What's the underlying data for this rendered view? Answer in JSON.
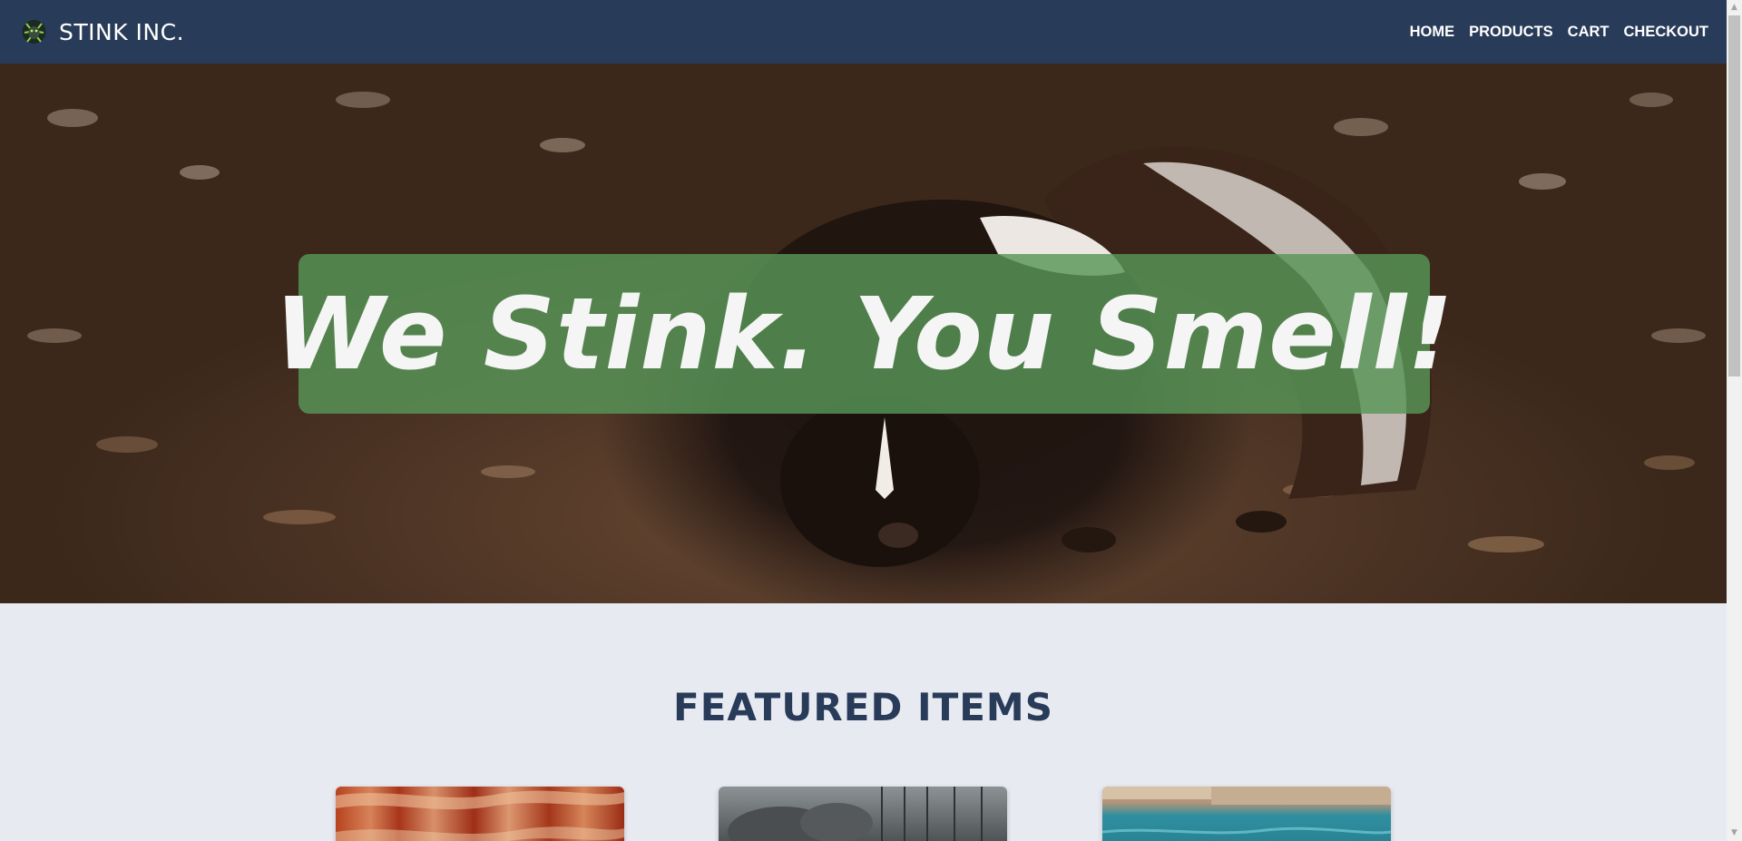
{
  "header": {
    "brand_name": "STINK INC.",
    "logo_icon": "skunk-logo-icon",
    "nav": [
      "HOME",
      "PRODUCTS",
      "CART",
      "CHECKOUT"
    ]
  },
  "hero": {
    "tagline": "We Stink. You Smell!",
    "image": "skunk-on-mulch-photo"
  },
  "featured": {
    "title": "FEATURED ITEMS",
    "cards": [
      "bacon-photo",
      "smoke-forest-photo",
      "pool-photo"
    ]
  },
  "colors": {
    "navbar": "#283b58",
    "banner": "#589658",
    "page_background": "#e8eaf2",
    "title_text": "#283b58"
  }
}
